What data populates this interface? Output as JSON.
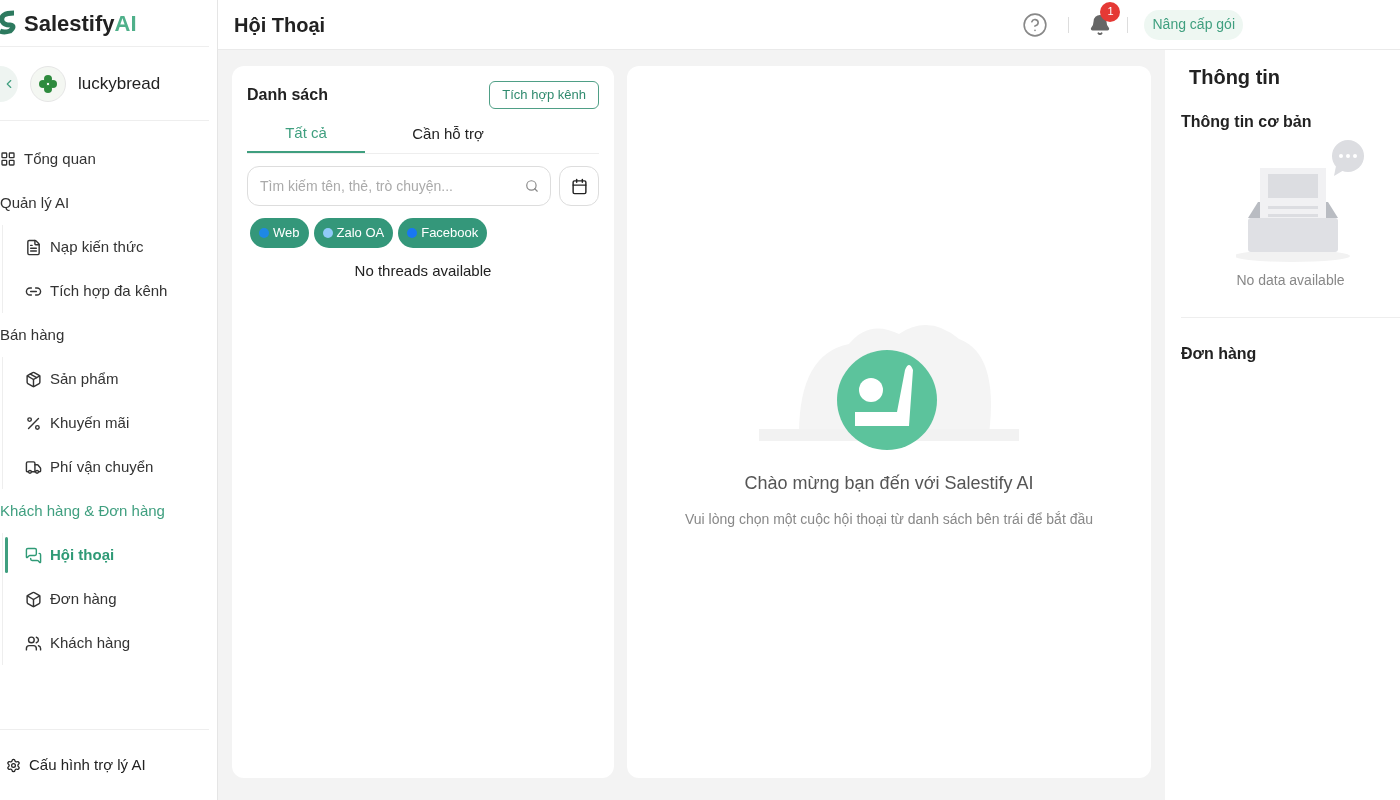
{
  "brand": {
    "name": "Salestify",
    "suffix": "AI"
  },
  "header": {
    "title": "Hội Thoại",
    "notifications": "1",
    "upgrade": "Nâng cấp gói"
  },
  "workspace": {
    "name": "luckybread"
  },
  "nav": [
    {
      "kind": "item",
      "label": "Tổng quan",
      "selected": false
    },
    {
      "kind": "section",
      "label": "Quản lý AI",
      "selected": false,
      "children": [
        {
          "label": "Nạp kiến thức",
          "selected": false
        },
        {
          "label": "Tích hợp đa kênh",
          "selected": false
        }
      ]
    },
    {
      "kind": "section",
      "label": "Bán hàng",
      "selected": false,
      "children": [
        {
          "label": "Sản phẩm",
          "selected": false
        },
        {
          "label": "Khuyến mãi",
          "selected": false
        },
        {
          "label": "Phí vận chuyển",
          "selected": false
        }
      ]
    },
    {
      "kind": "section",
      "label": "Khách hàng & Đơn hàng",
      "selected": true,
      "children": [
        {
          "label": "Hội thoại",
          "selected": true
        },
        {
          "label": "Đơn hàng",
          "selected": false
        },
        {
          "label": "Khách hàng",
          "selected": false
        }
      ]
    }
  ],
  "settings": {
    "label": "Cấu hình trợ lý AI"
  },
  "list": {
    "title": "Danh sách",
    "integrate_button": "Tích hợp kênh",
    "tabs": [
      {
        "label": "Tất cả",
        "selected": true
      },
      {
        "label": "Cần hỗ trợ",
        "selected": false
      }
    ],
    "search": {
      "placeholder": "Tìm kiếm tên, thẻ, trò chuyện..."
    },
    "channels": [
      {
        "label": "Web",
        "selected": true,
        "color": "#1e88e5"
      },
      {
        "label": "Zalo OA",
        "selected": true,
        "color": "#90caf9"
      },
      {
        "label": "Facebook",
        "selected": true,
        "color": "#1877f2"
      }
    ],
    "empty": "No threads available"
  },
  "welcome": {
    "title": "Chào mừng bạn đến với Salestify AI",
    "subtitle": "Vui lòng chọn một cuộc hội thoại từ danh sách bên trái để bắt đầu"
  },
  "info": {
    "title": "Thông tin",
    "basic_title": "Thông tin cơ bản",
    "basic_empty": "No data available",
    "orders_title": "Đơn hàng"
  }
}
